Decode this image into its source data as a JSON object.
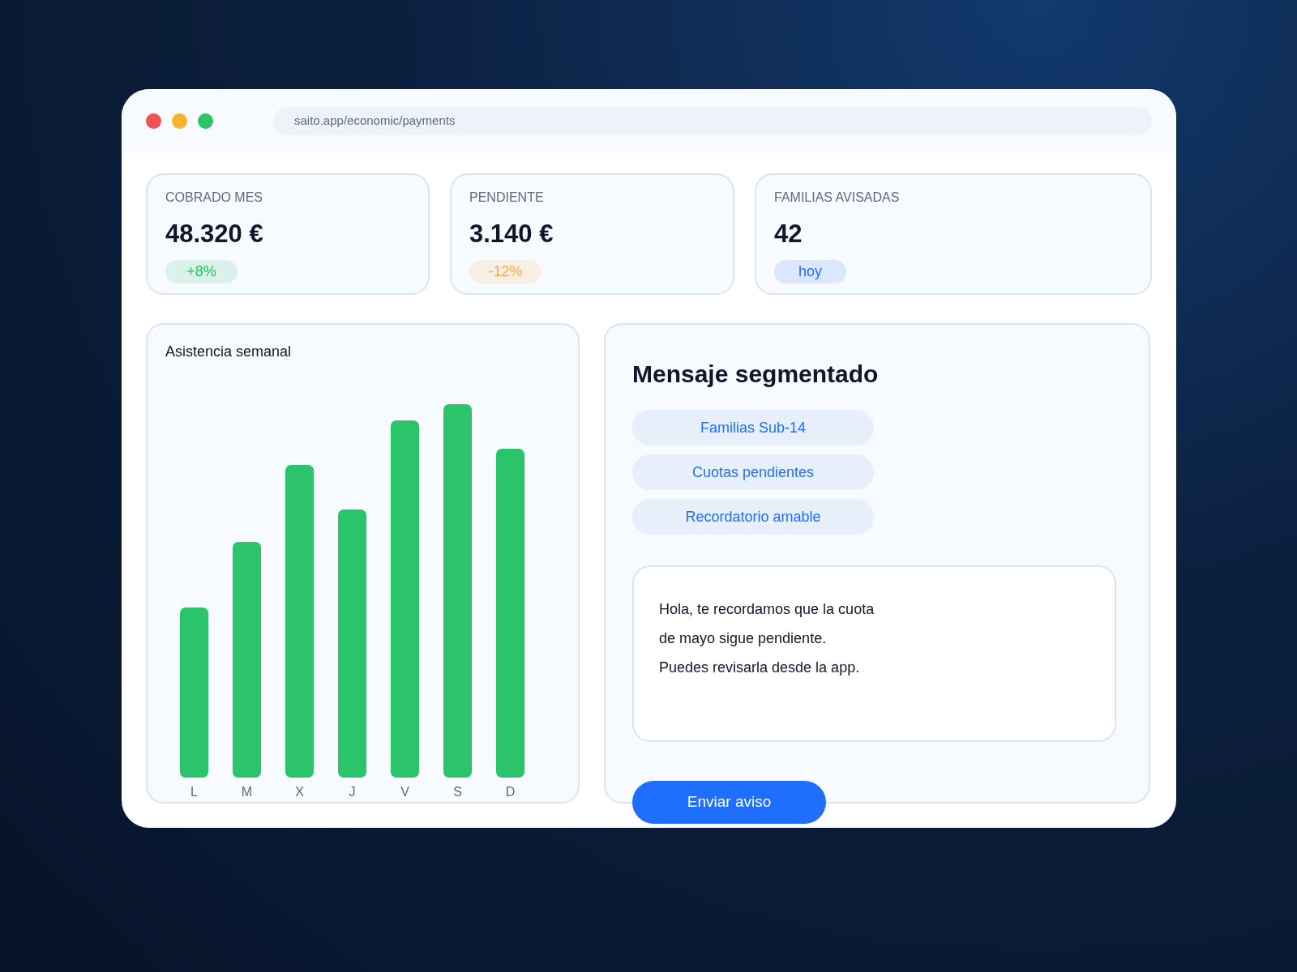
{
  "browser": {
    "url": "saito.app/economic/payments"
  },
  "stats": [
    {
      "label": "COBRADO MES",
      "value": "48.320 €",
      "badge": "+8%",
      "color": "#22c55e"
    },
    {
      "label": "PENDIENTE",
      "value": "3.140 €",
      "badge": "-12%",
      "color": "#f6ad3c"
    },
    {
      "label": "FAMILIAS AVISADAS",
      "value": "42",
      "badge": "hoy",
      "color": "#1f6fff"
    }
  ],
  "attendance": {
    "title": "Asistencia semanal",
    "days": [
      "L",
      "M",
      "X",
      "J",
      "V",
      "S",
      "D"
    ]
  },
  "message": {
    "title": "Mensaje segmentado",
    "segments": [
      "Familias Sub-14",
      "Cuotas pendientes",
      "Recordatorio amable"
    ],
    "text_lines": [
      "Hola, te recordamos que la cuota",
      "de mayo sigue pendiente.",
      "Puedes revisarla desde la app."
    ],
    "send_button": "Enviar aviso"
  }
}
